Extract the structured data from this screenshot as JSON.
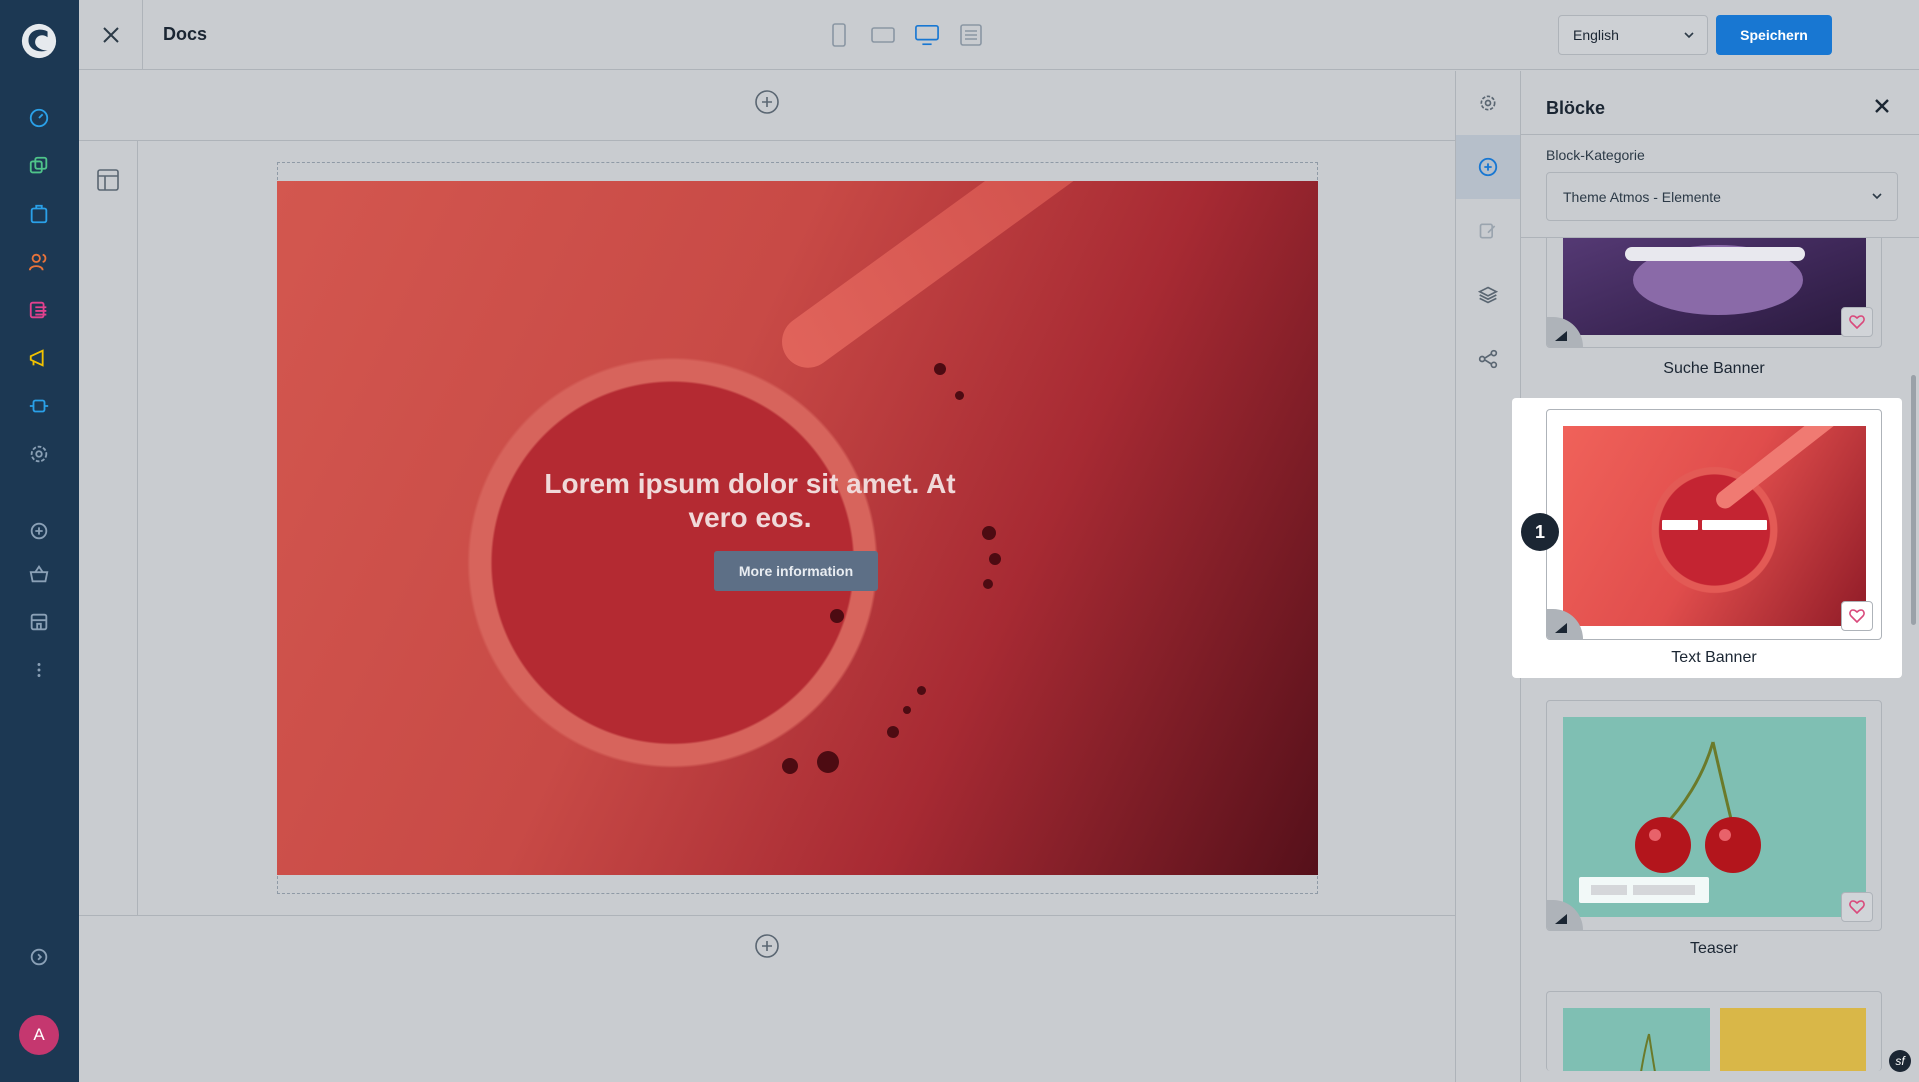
{
  "app": {
    "title": "Docs",
    "avatar_initial": "A"
  },
  "topbar": {
    "language": "English",
    "save_label": "Speichern",
    "viewports": [
      "mobile-icon",
      "tablet-landscape-icon",
      "desktop-icon",
      "list-view-icon"
    ],
    "active_viewport": "desktop-icon"
  },
  "banner": {
    "heading": "Lorem ipsum dolor sit amet. At vero eos.",
    "button_label": "More information"
  },
  "panel": {
    "title": "Blöcke",
    "category_label": "Block-Kategorie",
    "category_value": "Theme Atmos - Elemente",
    "blocks": [
      {
        "label": "Suche Banner"
      },
      {
        "label": "Text Banner",
        "highlighted": true,
        "step": "1"
      },
      {
        "label": "Teaser"
      }
    ]
  },
  "colors": {
    "nav_bg": "#1c3853",
    "primary": "#1877d2",
    "avatar": "#c5376f",
    "heart": "#d94a7c"
  }
}
